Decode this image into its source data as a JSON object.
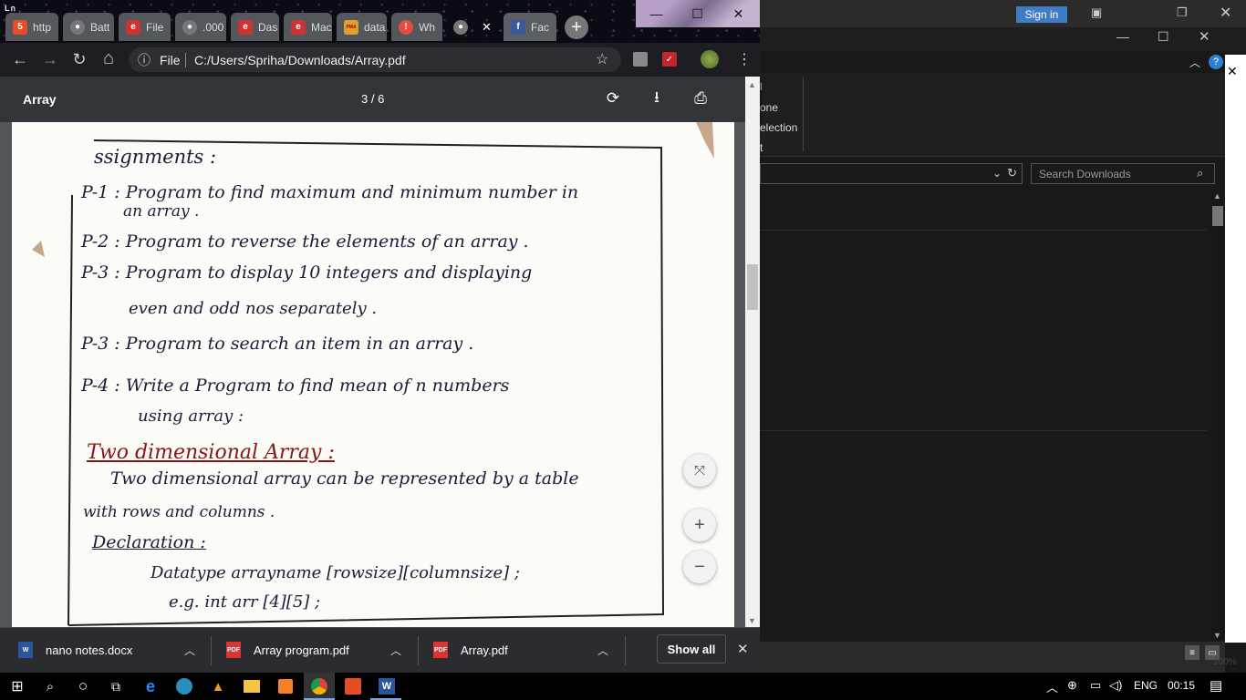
{
  "browser": {
    "tabs": [
      {
        "label": "http",
        "icon": "html5-icon",
        "color": "#e44d26"
      },
      {
        "label": "Batt",
        "icon": "globe-icon",
        "color": "#777"
      },
      {
        "label": "File",
        "icon": "edge-icon",
        "color": "#c33"
      },
      {
        "label": ".000",
        "icon": "globe-icon",
        "color": "#777"
      },
      {
        "label": "Das",
        "icon": "edge-icon",
        "color": "#c33"
      },
      {
        "label": "Mac",
        "icon": "edge-icon",
        "color": "#c33"
      },
      {
        "label": "data",
        "icon": "pma-icon",
        "color": "#e0a030"
      },
      {
        "label": "Wh",
        "icon": "alert-icon",
        "color": "#e74c3c"
      },
      {
        "label": "",
        "icon": "globe-icon",
        "color": "#777"
      },
      {
        "label": "Fac",
        "icon": "facebook-icon",
        "color": "#3b5998"
      }
    ],
    "pma_badge": "PMA",
    "omnibox": {
      "info": "ⓘ",
      "scheme": "File",
      "url": "C:/Users/Spriha/Downloads/Array.pdf"
    }
  },
  "pdf": {
    "title": "Array",
    "page_indicator": "3 / 6",
    "lines": [
      "ssignments :",
      "P-1 : Program to find maximum and minimum number in",
      "an array .",
      "P-2 : Program to reverse the elements of an array .",
      "P-3 : Program to display 10 integers and displaying",
      "even and odd nos separately .",
      "P-3 : Program to search an item in an array .",
      "P-4 : Write a Program to find mean of n numbers",
      "using array :",
      "Two dimensional Array :",
      "Two dimensional array can be represented by a table",
      "with rows and columns .",
      "Declaration :",
      "Datatype arrayname [rowsize][columnsize] ;",
      "e.g. int arr [4][5] ;"
    ]
  },
  "downloads": [
    {
      "name": "nano notes.docx",
      "type": "W"
    },
    {
      "name": "Array program.pdf",
      "type": "PDF"
    },
    {
      "name": "Array.pdf",
      "type": "PDF"
    }
  ],
  "show_all": "Show all",
  "explorer": {
    "signin": "Sign in",
    "ribbon": [
      "l",
      "one",
      "election",
      "t"
    ],
    "search_placeholder": "Search Downloads",
    "zoom": "100%"
  },
  "taskbar": {
    "lang": "ENG",
    "time": "00:15"
  }
}
